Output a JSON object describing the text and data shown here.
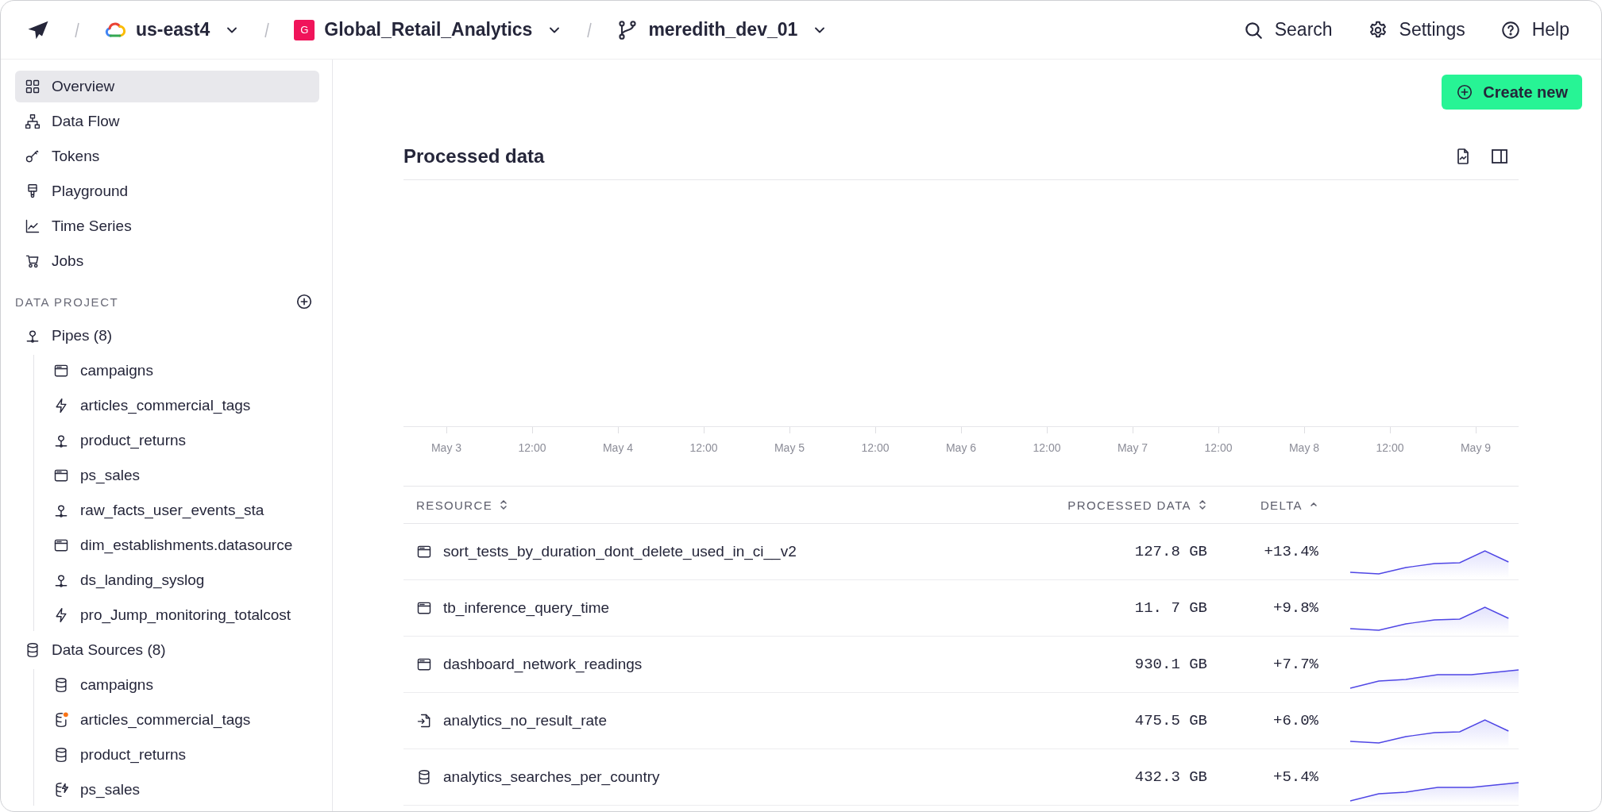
{
  "breadcrumbs": [
    {
      "kind": "region",
      "label": "us-east4"
    },
    {
      "kind": "workspace",
      "badge": "G",
      "label": "Global_Retail_Analytics"
    },
    {
      "kind": "branch",
      "label": "meredith_dev_01"
    }
  ],
  "top_actions": [
    {
      "kind": "search",
      "label": "Search"
    },
    {
      "kind": "settings",
      "label": "Settings"
    },
    {
      "kind": "help",
      "label": "Help"
    }
  ],
  "nav": [
    {
      "kind": "grid",
      "label": "Overview",
      "selected": true
    },
    {
      "kind": "hierarchy",
      "label": "Data Flow",
      "selected": false
    },
    {
      "kind": "key",
      "label": "Tokens",
      "selected": false
    },
    {
      "kind": "brush",
      "label": "Playground",
      "selected": false
    },
    {
      "kind": "chart-line",
      "label": "Time Series",
      "selected": false
    },
    {
      "kind": "cart",
      "label": "Jobs",
      "selected": false
    }
  ],
  "project": {
    "heading": "DATA PROJECT",
    "groups": [
      {
        "kind": "node",
        "label": "Pipes (8)",
        "children": [
          {
            "kind": "window",
            "label": "campaigns"
          },
          {
            "kind": "bolt",
            "label": "articles_commercial_tags"
          },
          {
            "kind": "node",
            "label": "product_returns"
          },
          {
            "kind": "window",
            "label": "ps_sales"
          },
          {
            "kind": "node",
            "label": "raw_facts_user_events_sta"
          },
          {
            "kind": "window",
            "label": "dim_establishments.datasource"
          },
          {
            "kind": "node",
            "label": "ds_landing_syslog"
          },
          {
            "kind": "bolt",
            "label": "pro_Jump_monitoring_totalcost"
          }
        ]
      },
      {
        "kind": "database",
        "label": "Data Sources (8)",
        "children": [
          {
            "kind": "database",
            "label": "campaigns"
          },
          {
            "kind": "database-dot",
            "label": "articles_commercial_tags"
          },
          {
            "kind": "database",
            "label": "product_returns"
          },
          {
            "kind": "database-bolt",
            "label": "ps_sales"
          }
        ]
      }
    ]
  },
  "create_button": "Create new",
  "panel": {
    "title": "Processed data",
    "x_labels": [
      "May 3",
      "12:00",
      "May 4",
      "12:00",
      "May 5",
      "12:00",
      "May 6",
      "12:00",
      "May 7",
      "12:00",
      "May 8",
      "12:00",
      "May 9"
    ]
  },
  "table": {
    "columns": [
      {
        "label": "RESOURCE",
        "sorted": false
      },
      {
        "label": "PROCESSED DATA",
        "sorted": false
      },
      {
        "label": "DELTA",
        "sorted": true
      }
    ],
    "rows": [
      {
        "kind": "window",
        "resource": "sort_tests_by_duration_dont_delete_used_in_ci__v2",
        "processed": "127.8 GB",
        "delta": "+13.4%"
      },
      {
        "kind": "window",
        "resource": "tb_inference_query_time",
        "processed": "11. 7 GB",
        "delta": "+9.8%"
      },
      {
        "kind": "window",
        "resource": "dashboard_network_readings",
        "processed": "930.1 GB",
        "delta": "+7.7%"
      },
      {
        "kind": "import",
        "resource": "analytics_no_result_rate",
        "processed": "475.5 GB",
        "delta": "+6.0%"
      },
      {
        "kind": "database",
        "resource": "analytics_searches_per_country",
        "processed": "432.3 GB",
        "delta": "+5.4%"
      }
    ]
  }
}
